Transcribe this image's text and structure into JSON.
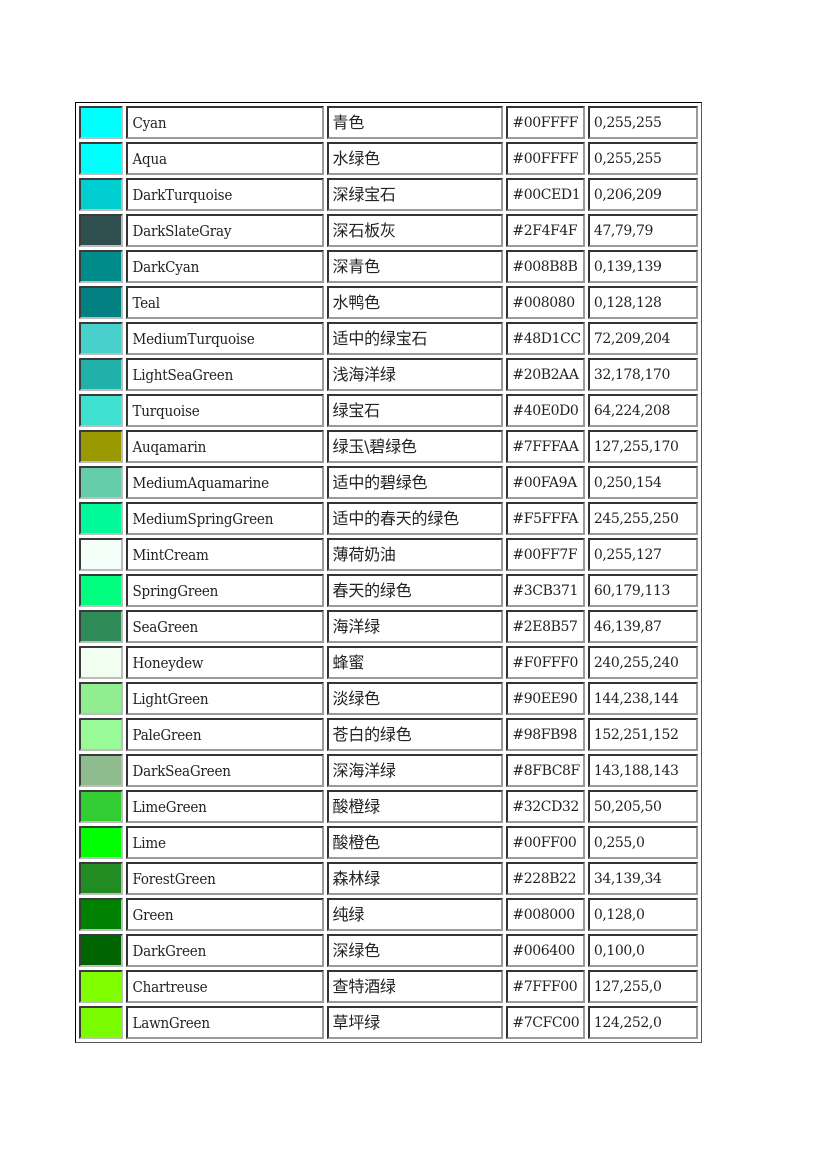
{
  "table": {
    "rows": [
      {
        "swatch": "#00FFFF",
        "name": "Cyan",
        "zh": "青色",
        "hex": "#00FFFF",
        "rgb": "0,255,255"
      },
      {
        "swatch": "#00FFFF",
        "name": "Aqua",
        "zh": "水绿色",
        "hex": "#00FFFF",
        "rgb": "0,255,255"
      },
      {
        "swatch": "#00CED1",
        "name": "DarkTurquoise",
        "zh": "深绿宝石",
        "hex": "#00CED1",
        "rgb": "0,206,209"
      },
      {
        "swatch": "#2F4F4F",
        "name": "DarkSlateGray",
        "zh": "深石板灰",
        "hex": "#2F4F4F",
        "rgb": "47,79,79"
      },
      {
        "swatch": "#008B8B",
        "name": "DarkCyan",
        "zh": "深青色",
        "hex": "#008B8B",
        "rgb": "0,139,139"
      },
      {
        "swatch": "#008080",
        "name": "Teal",
        "zh": "水鸭色",
        "hex": "#008080",
        "rgb": "0,128,128"
      },
      {
        "swatch": "#48D1CC",
        "name": "MediumTurquoise",
        "zh": "适中的绿宝石",
        "hex": "#48D1CC",
        "rgb": "72,209,204"
      },
      {
        "swatch": "#20B2AA",
        "name": "LightSeaGreen",
        "zh": "浅海洋绿",
        "hex": "#20B2AA",
        "rgb": "32,178,170"
      },
      {
        "swatch": "#40E0D0",
        "name": "Turquoise",
        "zh": "绿宝石",
        "hex": "#40E0D0",
        "rgb": "64,224,208"
      },
      {
        "swatch": "#9A9A00",
        "name": "Auqamarin",
        "zh": "绿玉\\碧绿色",
        "hex": "#7FFFAA",
        "rgb": "127,255,170"
      },
      {
        "swatch": "#66CDAA",
        "name": "MediumAquamarine",
        "zh": "适中的碧绿色",
        "hex": "#00FA9A",
        "rgb": "0,250,154"
      },
      {
        "swatch": "#00FA9A",
        "name": "MediumSpringGreen",
        "zh": "适中的春天的绿色",
        "hex": "#F5FFFA",
        "rgb": "245,255,250"
      },
      {
        "swatch": "#F5FFFA",
        "name": "MintCream",
        "zh": "薄荷奶油",
        "hex": "#00FF7F",
        "rgb": "0,255,127"
      },
      {
        "swatch": "#00FF7F",
        "name": "SpringGreen",
        "zh": "春天的绿色",
        "hex": "#3CB371",
        "rgb": "60,179,113"
      },
      {
        "swatch": "#2E8B57",
        "name": "SeaGreen",
        "zh": "海洋绿",
        "hex": "#2E8B57",
        "rgb": "46,139,87"
      },
      {
        "swatch": "#F0FFF0",
        "name": "Honeydew",
        "zh": "蜂蜜",
        "hex": "#F0FFF0",
        "rgb": "240,255,240"
      },
      {
        "swatch": "#90EE90",
        "name": "LightGreen",
        "zh": "淡绿色",
        "hex": "#90EE90",
        "rgb": "144,238,144"
      },
      {
        "swatch": "#98FB98",
        "name": "PaleGreen",
        "zh": "苍白的绿色",
        "hex": "#98FB98",
        "rgb": "152,251,152"
      },
      {
        "swatch": "#8FBC8F",
        "name": "DarkSeaGreen",
        "zh": "深海洋绿",
        "hex": "#8FBC8F",
        "rgb": "143,188,143"
      },
      {
        "swatch": "#32CD32",
        "name": "LimeGreen",
        "zh": "酸橙绿",
        "hex": "#32CD32",
        "rgb": "50,205,50"
      },
      {
        "swatch": "#00FF00",
        "name": "Lime",
        "zh": "酸橙色",
        "hex": "#00FF00",
        "rgb": "0,255,0"
      },
      {
        "swatch": "#228B22",
        "name": "ForestGreen",
        "zh": "森林绿",
        "hex": "#228B22",
        "rgb": "34,139,34"
      },
      {
        "swatch": "#008000",
        "name": "Green",
        "zh": "纯绿",
        "hex": "#008000",
        "rgb": "0,128,0"
      },
      {
        "swatch": "#006400",
        "name": "DarkGreen",
        "zh": "深绿色",
        "hex": "#006400",
        "rgb": "0,100,0"
      },
      {
        "swatch": "#7FFF00",
        "name": "Chartreuse",
        "zh": "查特酒绿",
        "hex": "#7FFF00",
        "rgb": "127,255,0"
      },
      {
        "swatch": "#7CFC00",
        "name": "LawnGreen",
        "zh": "草坪绿",
        "hex": "#7CFC00",
        "rgb": "124,252,0"
      }
    ]
  }
}
